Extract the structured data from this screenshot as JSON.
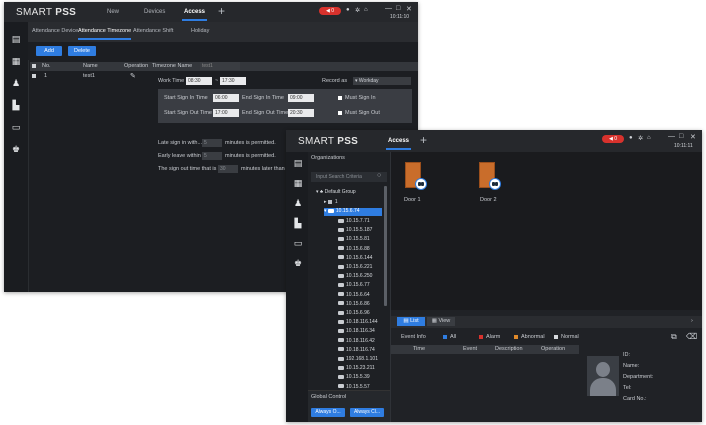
{
  "back_window": {
    "brand_light": "SMART ",
    "brand_bold": "PSS",
    "tabs": [
      "New",
      "Devices",
      "Access"
    ],
    "active_tab": "Access",
    "alarm_count": "0",
    "clock": "10:11:10",
    "subtabs": [
      "Attendance Device",
      "Attendance Timezone",
      "Attendance Shift",
      "Holiday"
    ],
    "active_subtab": "Attendance Timezone",
    "add_label": "Add",
    "delete_label": "Delete",
    "table_headers": {
      "no": "No.",
      "name": "Name",
      "operation": "Operation"
    },
    "row": {
      "no": "1",
      "name": "test1"
    },
    "timezone_name_label": "Timezone Name",
    "timezone_name_value": "test1",
    "work_time_label": "Work Time",
    "work_time_start": "08:30",
    "work_time_end": "17:30",
    "record_as_label": "Record as",
    "record_as_value": "Workday",
    "start_signin_label": "Start Sign In Time",
    "start_signin_value": "06:00",
    "end_signin_label": "End Sign In Time",
    "end_signin_value": "09:00",
    "must_signin_label": "Must Sign In",
    "start_signout_label": "Start Sign Out Time",
    "start_signout_value": "17:00",
    "end_signout_label": "End Sign Out Time",
    "end_signout_value": "20:30",
    "must_signout_label": "Must Sign Out",
    "late_label": "Late sign in with...",
    "late_value": "5",
    "late_suffix": "minutes is permitted.",
    "early_label": "Early leave within",
    "early_value": "5",
    "early_suffix": "minutes is permitted.",
    "signout_label": "The sign out time that is",
    "signout_value": "30",
    "signout_suffix": "minutes later than off"
  },
  "front_window": {
    "brand_light": "SMART ",
    "brand_bold": "PSS",
    "tab": "Access",
    "alarm_count": "0",
    "clock": "10:11:11",
    "organizations_label": "Organizations",
    "search_placeholder": "Input Search Criteria",
    "default_group": "Default Group",
    "group_node": "1",
    "selected_node": "10.15.6.74",
    "devices": [
      "10.15.7.71",
      "10.15.5.187",
      "10.15.5.81",
      "10.15.6.88",
      "10.15.6.144",
      "10.15.6.221",
      "10.15.6.250",
      "10.15.6.77",
      "10.15.6.64",
      "10.15.6.86",
      "10.15.6.96",
      "10.18.116.144",
      "10.18.116.34",
      "10.18.116.42",
      "10.18.116.74",
      "192.168.1.101",
      "10.15.23.211",
      "10.15.5.39",
      "10.15.5.57"
    ],
    "global_control_label": "Global Control",
    "always_open_label": "Always O...",
    "always_close_label": "Always Cl...",
    "doors": [
      "Door 1",
      "Door 2"
    ],
    "view_tabs": [
      "List",
      "View"
    ],
    "event_info_label": "Event Info",
    "filters": [
      "All",
      "Alarm",
      "Abnormal",
      "Normal"
    ],
    "event_columns": [
      "Time",
      "Event",
      "Description",
      "Operation"
    ],
    "info_fields": [
      "ID:",
      "Name:",
      "Department:",
      "Tel:",
      "Card No.:"
    ]
  }
}
